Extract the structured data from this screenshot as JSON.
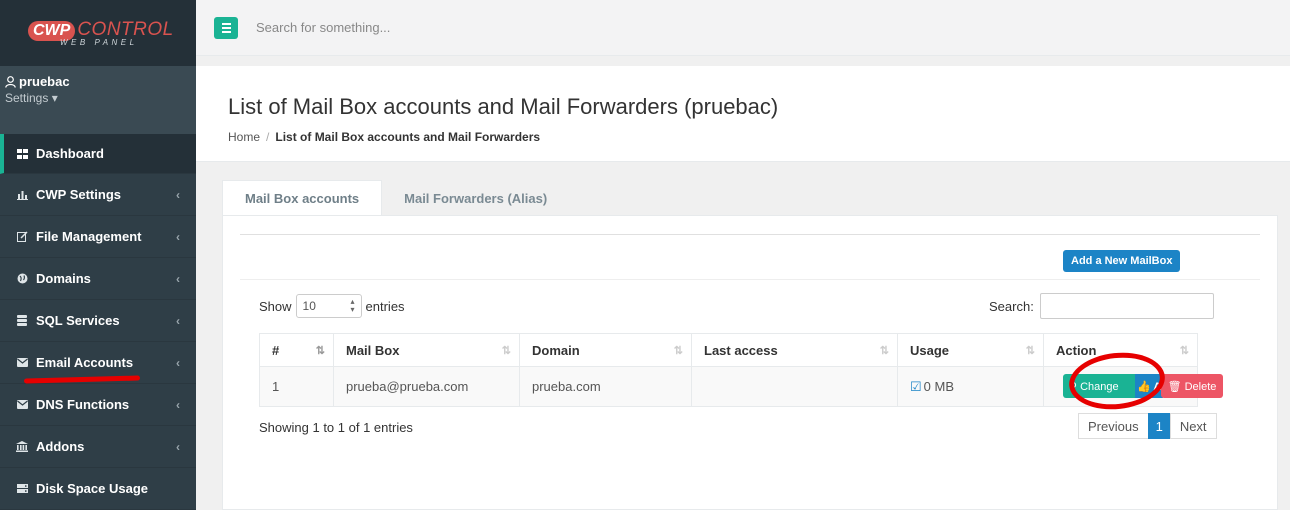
{
  "logo": {
    "cwp": "CWP",
    "control": "CONTROL",
    "sub": "WEB PANEL"
  },
  "user": {
    "name": "pruebac",
    "settings": "Settings ▾"
  },
  "sidebar": {
    "items": [
      {
        "label": "Dashboard",
        "icon": "grid-icon"
      },
      {
        "label": "CWP Settings",
        "icon": "bar-chart-icon"
      },
      {
        "label": "File Management",
        "icon": "edit-icon"
      },
      {
        "label": "Domains",
        "icon": "globe-icon"
      },
      {
        "label": "SQL Services",
        "icon": "database-icon"
      },
      {
        "label": "Email Accounts",
        "icon": "envelope-icon"
      },
      {
        "label": "DNS Functions",
        "icon": "envelope-icon"
      },
      {
        "label": "Addons",
        "icon": "bank-icon"
      },
      {
        "label": "Disk Space Usage",
        "icon": "hdd-icon"
      }
    ],
    "chevron": "‹"
  },
  "topbar": {
    "search_placeholder": "Search for something..."
  },
  "heading": {
    "title": "List of Mail Box accounts and Mail Forwarders (pruebac)",
    "breadcrumb_home": "Home",
    "breadcrumb_sep": "/",
    "breadcrumb_current": "List of Mail Box accounts and Mail Forwarders"
  },
  "tabs": [
    {
      "label": "Mail Box accounts"
    },
    {
      "label": "Mail Forwarders (Alias)"
    }
  ],
  "panel": {
    "add_button": "Add a New MailBox",
    "show_label": "Show",
    "entries_value": "10",
    "entries_label": "entries",
    "search_label": "Search:",
    "columns": [
      "#",
      "Mail Box",
      "Domain",
      "Last access",
      "Usage",
      "Action"
    ],
    "rows": [
      {
        "num": "1",
        "mailbox": "prueba@prueba.com",
        "domain": "prueba.com",
        "last_access": "",
        "usage": "0 MB"
      }
    ],
    "actions": {
      "change": "⚲ Change",
      "ac": "👍 Ac",
      "delete": "🗑 Delete"
    },
    "info": "Showing 1 to 1 of 1 entries",
    "pager": {
      "previous": "Previous",
      "page": "1",
      "next": "Next"
    }
  },
  "colors": {
    "accent": "#1ab394",
    "primary": "#1c84c6",
    "danger": "#ed5565",
    "sidebar": "#2f3e47"
  }
}
